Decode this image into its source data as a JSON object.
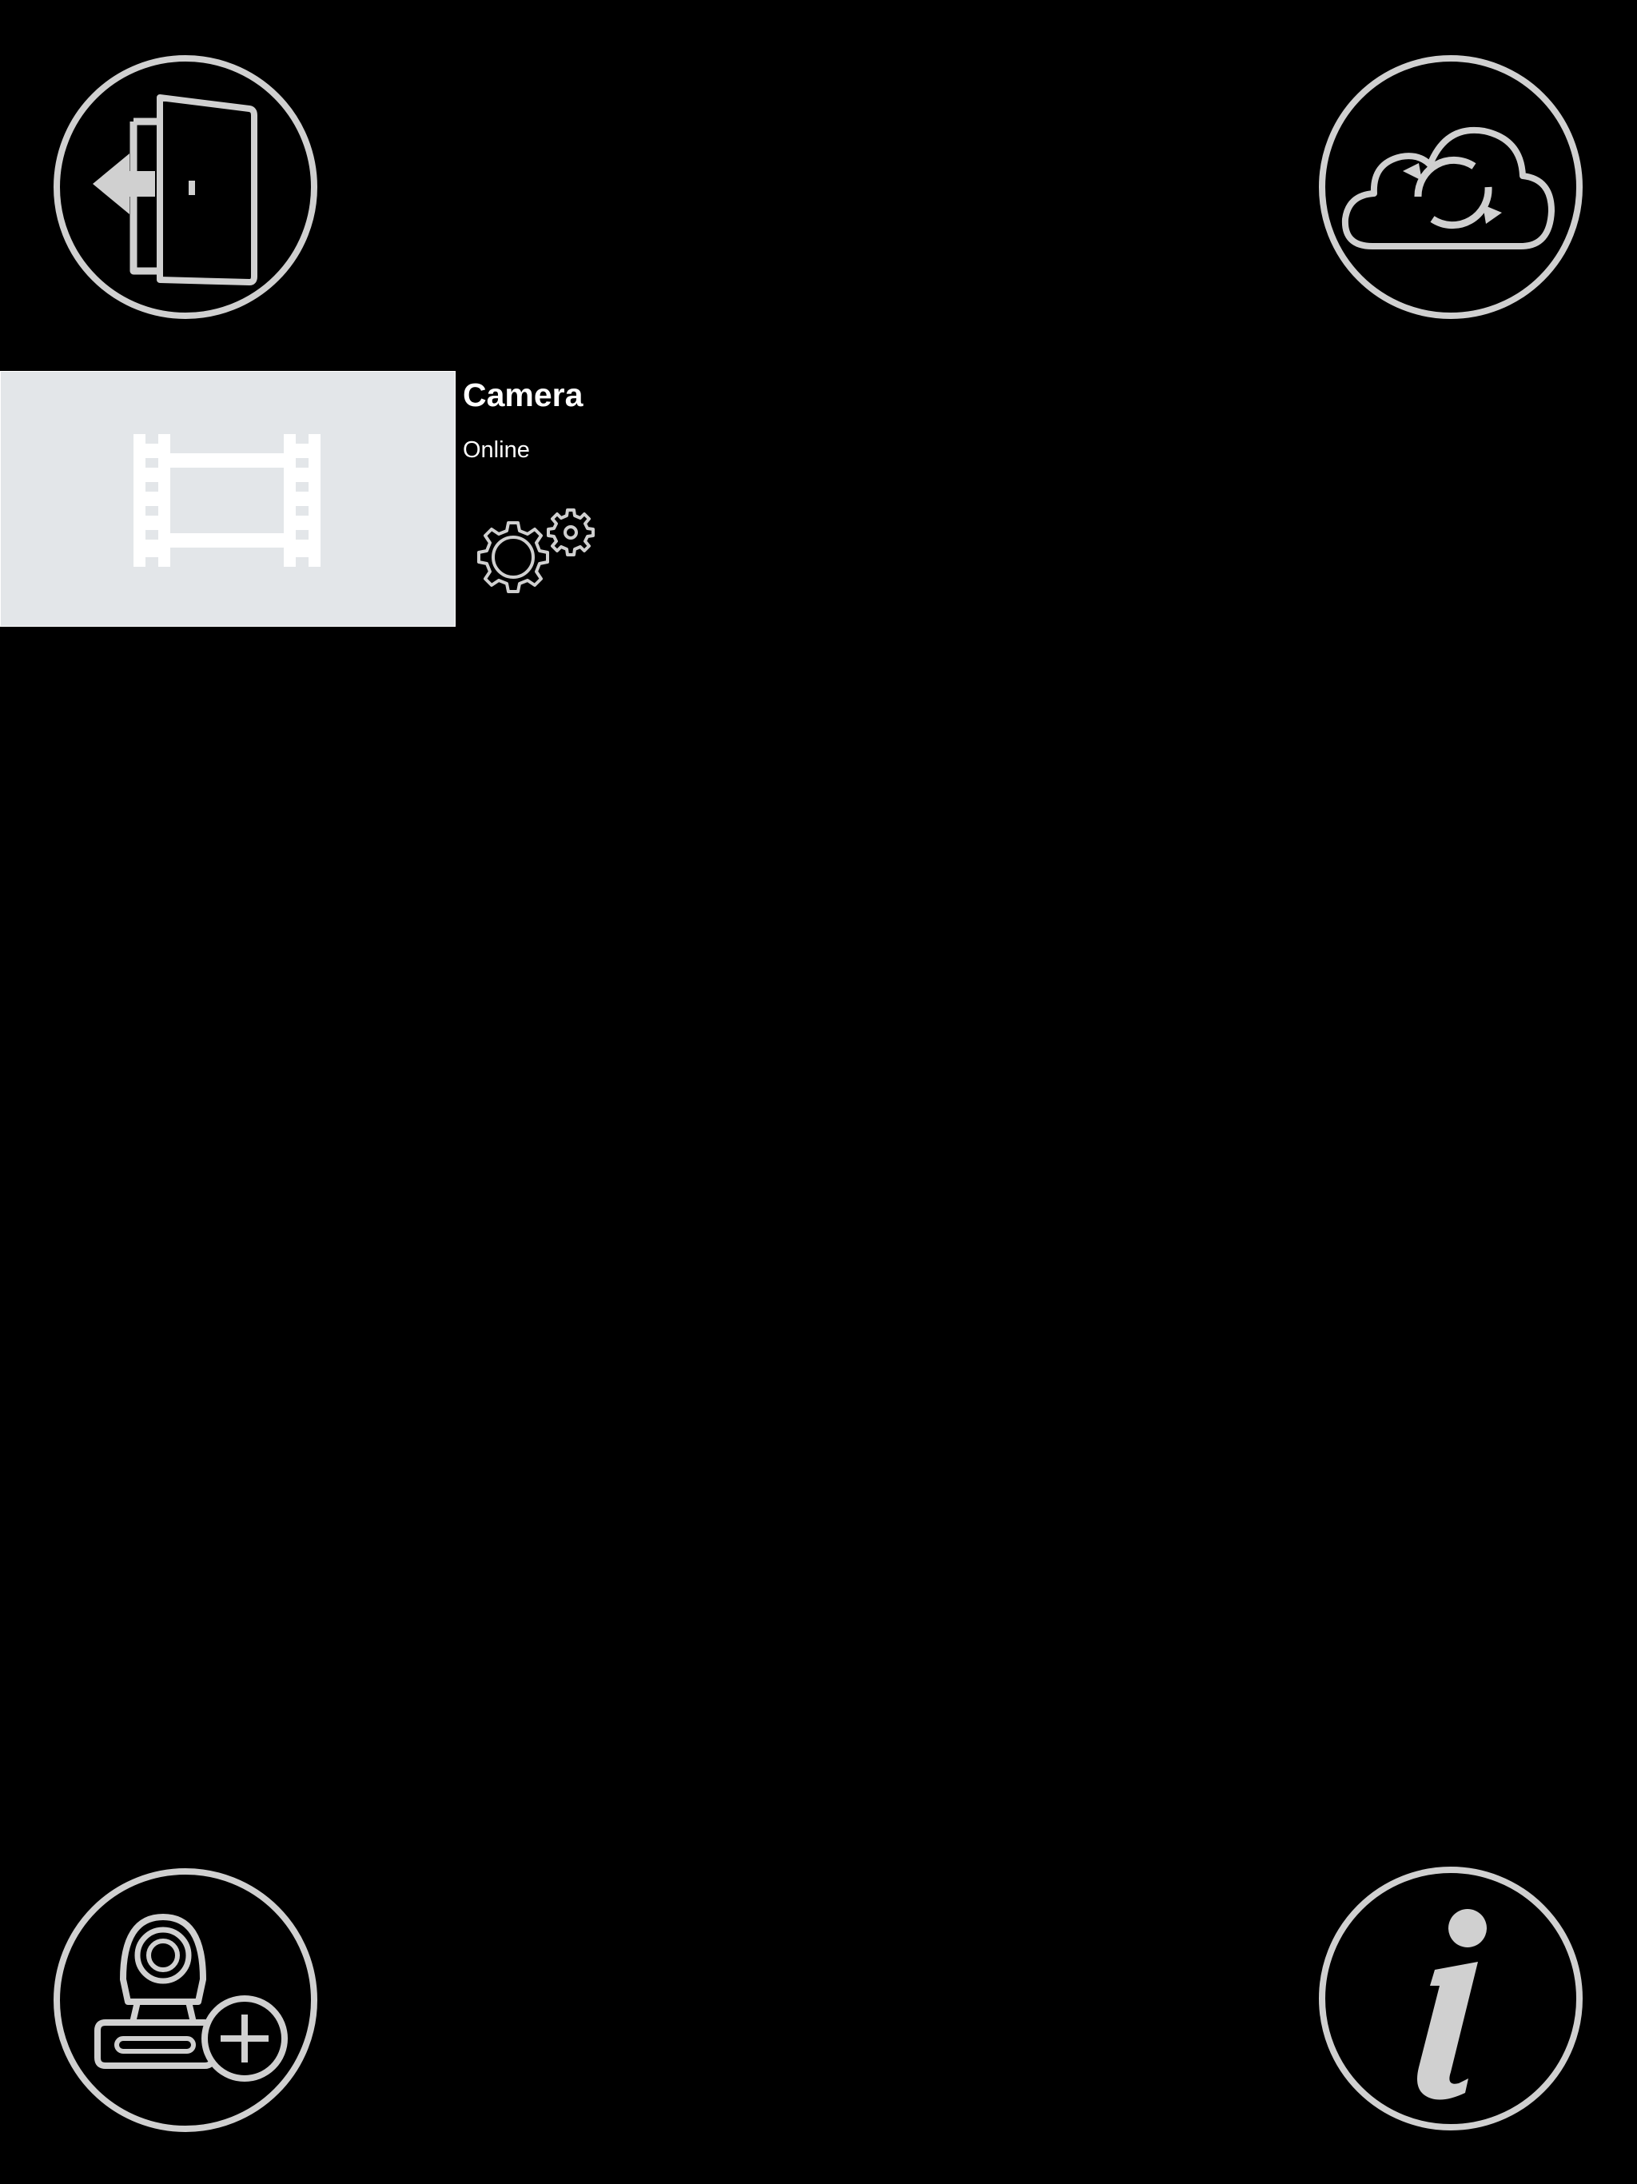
{
  "toolbar": {
    "logout_icon": "logout-door-icon",
    "sync_icon": "cloud-sync-icon",
    "add_camera_icon": "add-camera-icon",
    "info_icon": "info-icon"
  },
  "cameras": [
    {
      "name": "Camera",
      "status": "Online",
      "thumbnail_icon": "film-strip-icon",
      "settings_icon": "gears-icon"
    }
  ],
  "colors": {
    "background": "#000000",
    "icon_stroke": "#d0d0d0",
    "thumbnail_bg": "#e3e6e9",
    "text": "#ffffff"
  }
}
